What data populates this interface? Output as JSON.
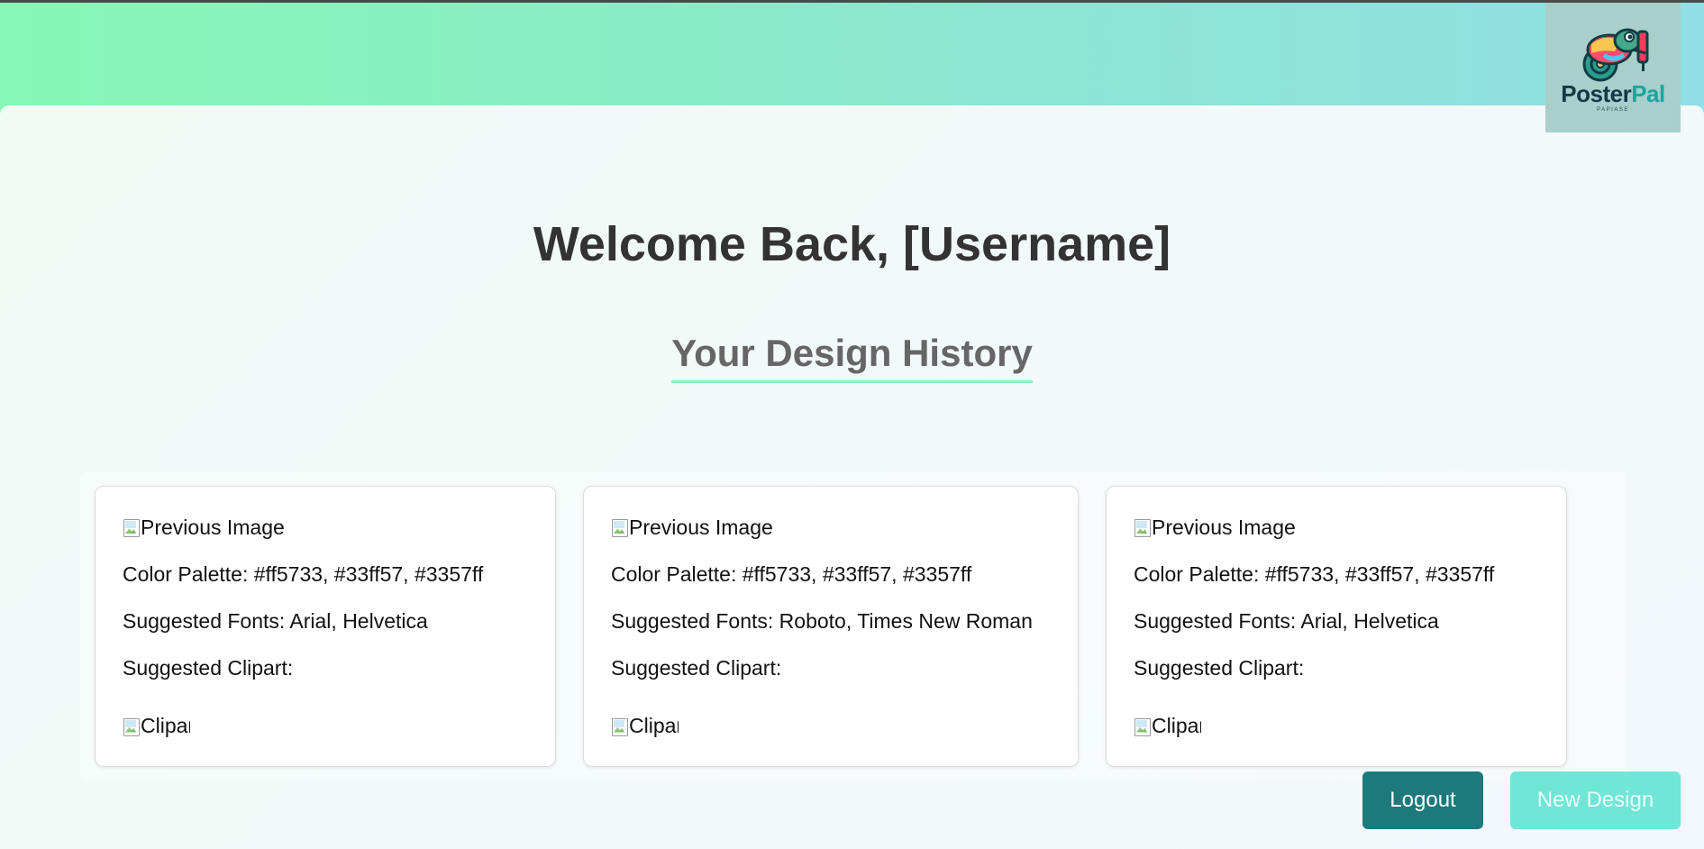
{
  "brand": {
    "name_part1": "Poster",
    "name_part2": "Pal",
    "tagline": "PAPIASE"
  },
  "header": {
    "welcome": "Welcome Back, [Username]",
    "history_title": "Your Design History"
  },
  "cards": [
    {
      "image_alt": "Previous Image",
      "palette": "Color Palette: #ff5733, #33ff57, #3357ff",
      "fonts": "Suggested Fonts: Arial, Helvetica",
      "clipart_label": "Suggested Clipart:",
      "clipart_alt": "Clipart"
    },
    {
      "image_alt": "Previous Image",
      "palette": "Color Palette: #ff5733, #33ff57, #3357ff",
      "fonts": "Suggested Fonts: Roboto, Times New Roman",
      "clipart_label": "Suggested Clipart:",
      "clipart_alt": "Clipart"
    },
    {
      "image_alt": "Previous Image",
      "palette": "Color Palette: #ff5733, #33ff57, #3357ff",
      "fonts": "Suggested Fonts: Arial, Helvetica",
      "clipart_label": "Suggested Clipart:",
      "clipart_alt": "Clipart"
    }
  ],
  "buttons": {
    "logout": "Logout",
    "new_design": "New Design"
  },
  "colors": {
    "header_gradient_start": "#86f7b4",
    "header_gradient_end": "#8fdfe6",
    "logout_button": "#1d7a7c",
    "new_design_button": "#6fe6d8",
    "underline_accent": "#8ff0c0"
  },
  "icons": {
    "logo": "chameleon-logo-icon",
    "broken_image": "broken-image-icon"
  }
}
